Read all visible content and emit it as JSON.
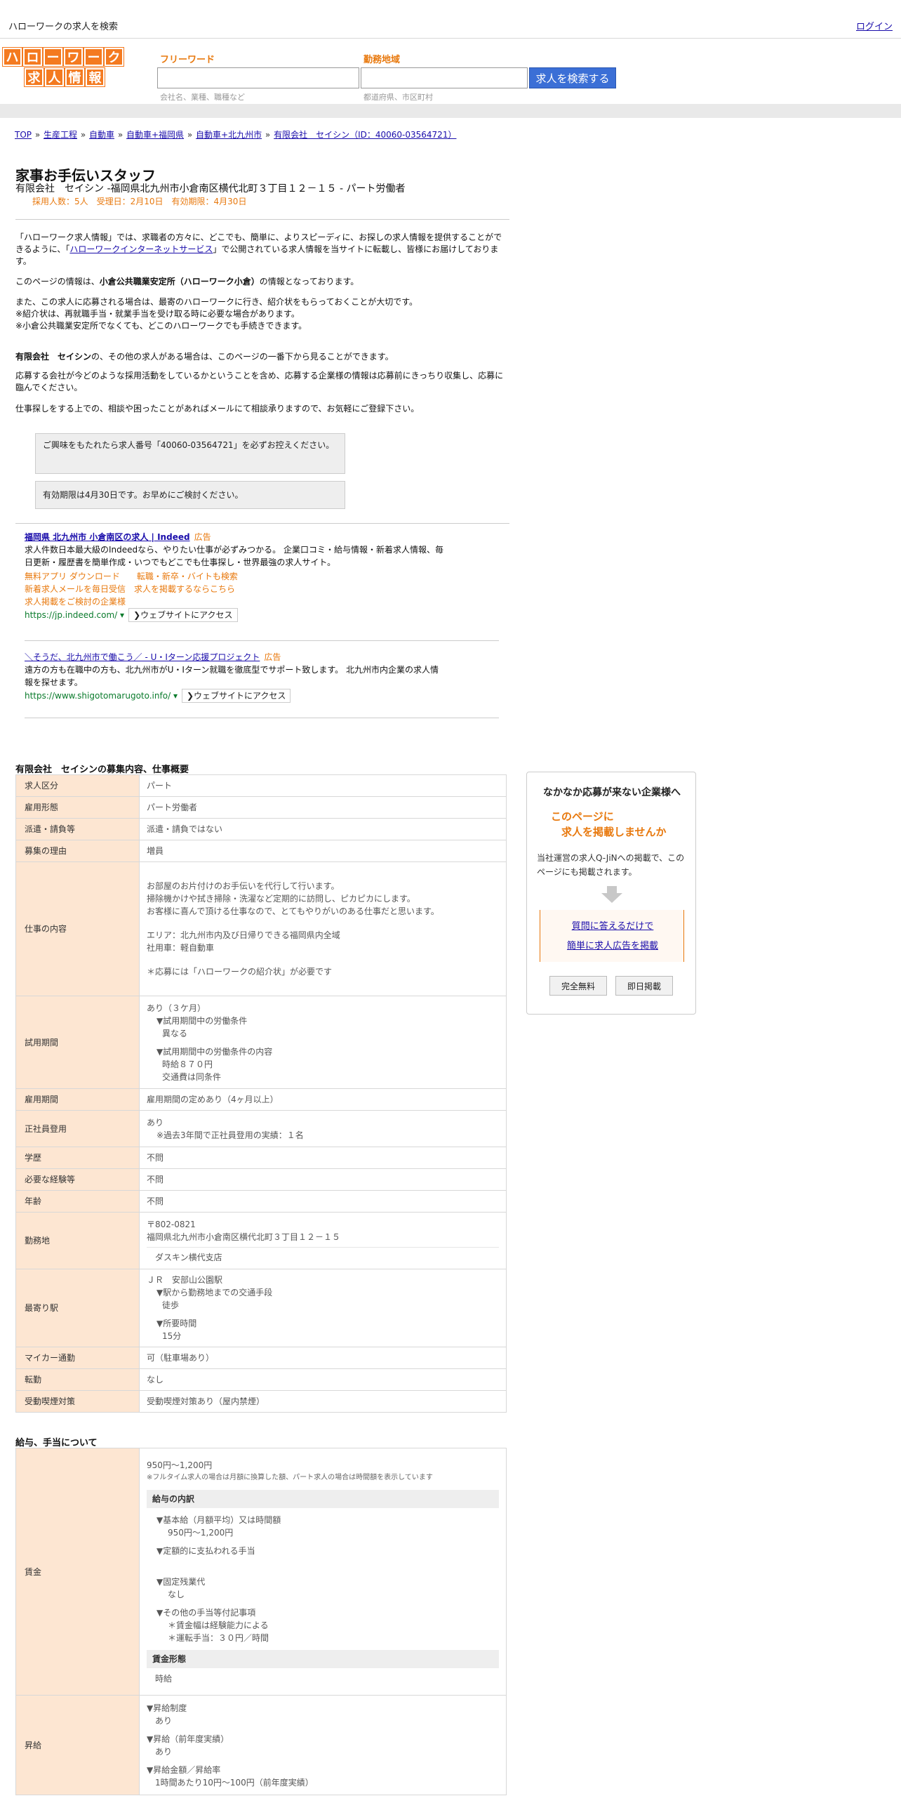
{
  "topbar": {
    "title": "ハローワークの求人を検索",
    "login": "ログイン"
  },
  "logo": {
    "row1": [
      "ハ",
      "ロ",
      "ー",
      "ワ",
      "ー",
      "ク"
    ],
    "row2": [
      "求",
      "人",
      "情",
      "報"
    ]
  },
  "search": {
    "freeword_label": "フリーワード",
    "freeword_hint": "会社名、業種、職種など",
    "area_label": "勤務地域",
    "area_hint": "都道府県、市区町村",
    "button": "求人を検索する"
  },
  "breadcrumb": [
    "TOP",
    "生産工程",
    "自動車",
    "自動車+福岡県",
    "自動車+北九州市",
    "有限会社　セイシン（ID：40060-03564721）"
  ],
  "job": {
    "title": "家事お手伝いスタッフ",
    "subtitle": "有限会社　セイシン -福岡県北九州市小倉南区横代北町３丁目１２－１５ - パート労働者",
    "meta": "採用人数：5人　受理日：2月10日　有効期限：4月30日"
  },
  "intro": {
    "p1a": "「ハローワーク求人情報」では、求職者の方々に、どこでも、簡単に、よりスピーディに、お探しの求人情報を提供することができるように、「",
    "p1link": "ハローワークインターネットサービス",
    "p1b": "」で公開されている求人情報を当サイトに転載し、皆様にお届けしております。",
    "p2a": "このページの情報は、",
    "p2b": "小倉公共職業安定所（ハローワーク小倉）",
    "p2c": "の情報となっております。",
    "p3": "また、この求人に応募される場合は、最寄のハローワークに行き、紹介状をもらっておくことが大切です。",
    "p3b": "※紹介状は、再就職手当・就業手当を受け取る時に必要な場合があります。",
    "p3c": "※小倉公共職業安定所でなくても、どこのハローワークでも手続きできます。",
    "p4a": "有限会社　セイシン",
    "p4b": "の、その他の求人がある場合は、このページの一番下から見ることができます。",
    "p5": "応募する会社が今どのような採用活動をしているかということを含め、応募する企業様の情報は応募前にきっちり収集し、応募に臨んでください。",
    "p6": "仕事探しをする上での、相談や困ったことがあればメールにて相談承りますので、お気軽にご登録下さい。"
  },
  "notes": {
    "n1": "ご興味をもたれたら求人番号「40060-03564721」を必ずお控えください。",
    "n2": "有効期限は4月30日です。お早めにご検討ください。"
  },
  "ads": [
    {
      "title": "福岡県 北九州市 小倉南区の求人 | Indeed",
      "tag": "広告",
      "desc": "求人件数日本最大級のIndeedなら、やりたい仕事が必ずみつかる。 企業口コミ・給与情報・新着求人情報、毎日更新・履歴書を簡単作成・いつでもどこでも仕事探し・世界最強の求人サイト。",
      "links1": "無料アプリ ダウンロード　　転職・新卒・バイトも検索",
      "links2": "新着求人メールを毎日受信　求人を掲載するならこちら",
      "links3": "求人掲載をご検討の企業様",
      "url": "https://jp.indeed.com/",
      "visit": "❯ウェブサイトにアクセス"
    },
    {
      "title": "＼そうだ、北九州市で働こう／ - U・Iターン応援プロジェクト",
      "tag": "広告",
      "desc": "遠方の方も在職中の方も、北九州市がU・Iターン就職を徹底型でサポート致します。 北九州市内企業の求人情報を探せます。",
      "url": "https://www.shigotomarugoto.info/",
      "visit": "❯ウェブサイトにアクセス"
    }
  ],
  "overview": {
    "heading": "有限会社　セイシンの募集内容、仕事概要",
    "rows": {
      "kubun": [
        "求人区分",
        "パート"
      ],
      "keitai": [
        "雇用形態",
        "パート労働者"
      ],
      "haken": [
        "派遣・請負等",
        "派遣・請負ではない"
      ],
      "riyu": [
        "募集の理由",
        "増員"
      ],
      "naiyo_k": "仕事の内容",
      "naiyo": [
        "お部屋のお片付けのお手伝いを代行して行います。",
        "掃除機かけや拭き掃除・洗濯など定期的に訪問し、ピカピカにします。",
        "お客様に喜んで頂ける仕事なので、とてもやりがいのある仕事だと思います。",
        "エリア：北九州市内及び日帰りできる福岡県内全域",
        "社用車：軽自動車",
        "＊応募には「ハローワークの紹介状」が必要です"
      ],
      "shiyo_k": "試用期間",
      "shiyo": [
        "あり（３ケ月）",
        "▼試用期間中の労働条件",
        "異なる",
        "▼試用期間中の労働条件の内容",
        "時給８７０円",
        "交通費は同条件"
      ],
      "kikan": [
        "雇用期間",
        "雇用期間の定めあり（4ヶ月以上）"
      ],
      "seishain_k": "正社員登用",
      "seishain": [
        "あり",
        "※過去3年間で正社員登用の実績：１名"
      ],
      "gakureki": [
        "学歴",
        "不問"
      ],
      "keiken": [
        "必要な経験等",
        "不問"
      ],
      "nenrei": [
        "年齢",
        "不問"
      ],
      "kinmuchi_k": "勤務地",
      "kinmuchi": [
        "〒802-0821",
        "福岡県北九州市小倉南区横代北町３丁目１２－１５",
        "ダスキン横代支店"
      ],
      "eki_k": "最寄り駅",
      "eki": [
        "ＪＲ　安部山公園駅",
        "▼駅から勤務地までの交通手段",
        "徒歩",
        "▼所要時間",
        "15分"
      ],
      "mycar": [
        "マイカー通勤",
        "可（駐車場あり）"
      ],
      "tenkin": [
        "転勤",
        "なし"
      ],
      "kitsuen": [
        "受動喫煙対策",
        "受動喫煙対策あり（屋内禁煙）"
      ]
    }
  },
  "salary": {
    "heading": "給与、手当について",
    "chingin_k": "賃金",
    "range": "950円〜1,200円",
    "note": "※フルタイム求人の場合は月額に換算した額、パート求人の場合は時間額を表示しています",
    "breakdown_title": "給与の内訳",
    "b1": "▼基本給（月額平均）又は時間額",
    "b1v": "950円〜1,200円",
    "b2": "▼定額的に支払われる手当",
    "b3": "▼固定残業代",
    "b3v": "なし",
    "b4": "▼その他の手当等付記事項",
    "b4v1": "＊賃金幅は経験能力による",
    "b4v2": "＊運転手当：３０円／時間",
    "form_title": "賃金形態",
    "form_v": "時給",
    "shokyu_k": "昇給",
    "s1": "▼昇給制度",
    "s1v": "あり",
    "s2": "▼昇給（前年度実績）",
    "s2v": "あり",
    "s3": "▼昇給金額／昇給率",
    "s3v": "1時間あたり10円〜100円（前年度実績）"
  },
  "sidebar": {
    "title": "なかなか応募が来ない企業様へ",
    "catch1": "このページに",
    "catch2": "　求人を掲載しませんか",
    "text": "当社運営の求人Q-JiNへの掲載で、このページにも掲載されます。",
    "link1": "質問に答えるだけで",
    "link2": "簡単に求人広告を掲載",
    "btn1": "完全無料",
    "btn2": "即日掲載"
  }
}
